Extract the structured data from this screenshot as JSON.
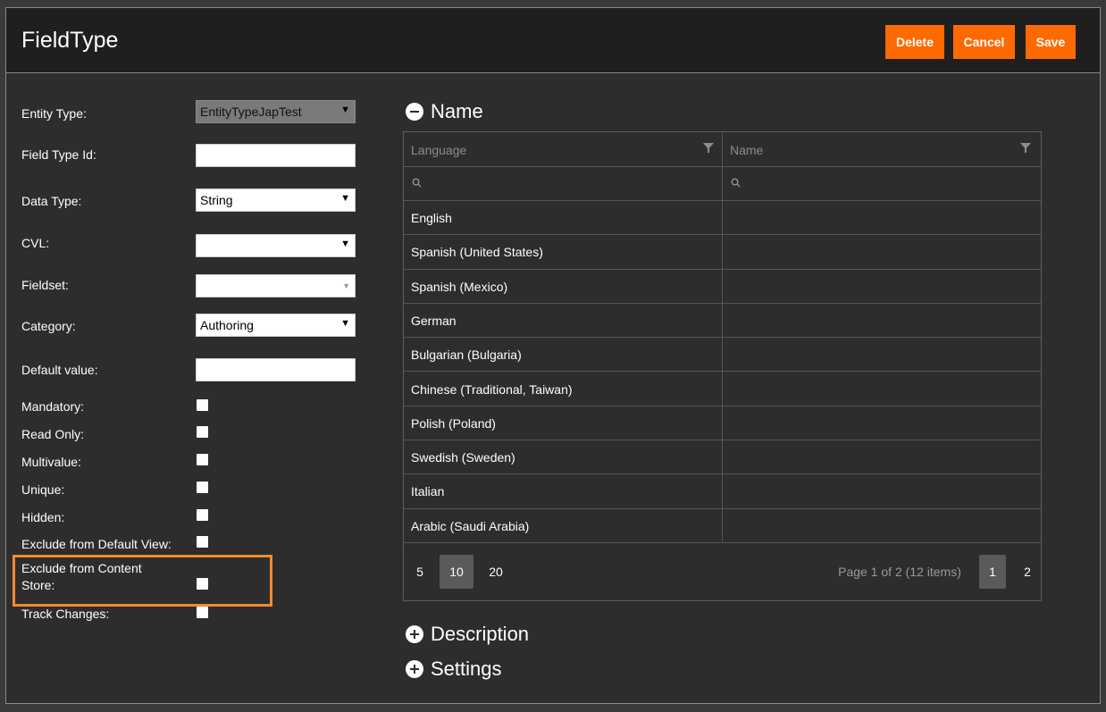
{
  "header": {
    "title": "FieldType",
    "delete_label": "Delete",
    "cancel_label": "Cancel",
    "save_label": "Save"
  },
  "form": {
    "entity_type": {
      "label": "Entity Type:",
      "value": "EntityTypeJapTest"
    },
    "field_type_id": {
      "label": "Field Type Id:",
      "value": ""
    },
    "data_type": {
      "label": "Data Type:",
      "value": "String"
    },
    "cvl": {
      "label": "CVL:",
      "value": ""
    },
    "fieldset": {
      "label": "Fieldset:",
      "value": ""
    },
    "category": {
      "label": "Category:",
      "value": "Authoring"
    },
    "default_value": {
      "label": "Default value:",
      "value": ""
    },
    "mandatory": {
      "label": "Mandatory:"
    },
    "read_only": {
      "label": "Read Only:"
    },
    "multivalue": {
      "label": "Multivalue:"
    },
    "unique": {
      "label": "Unique:"
    },
    "hidden": {
      "label": "Hidden:"
    },
    "exclude_default_view": {
      "label": "Exclude from Default View:"
    },
    "exclude_content_store": {
      "label_line1": "Exclude from Content",
      "label_line2": "Store:"
    },
    "track_changes": {
      "label": "Track Changes:"
    }
  },
  "name_section": {
    "title": "Name",
    "columns": [
      "Language",
      "Name"
    ],
    "rows": [
      {
        "language": "English",
        "name": ""
      },
      {
        "language": "Spanish (United States)",
        "name": ""
      },
      {
        "language": "Spanish (Mexico)",
        "name": ""
      },
      {
        "language": "German",
        "name": ""
      },
      {
        "language": "Bulgarian (Bulgaria)",
        "name": ""
      },
      {
        "language": "Chinese (Traditional, Taiwan)",
        "name": ""
      },
      {
        "language": "Polish (Poland)",
        "name": ""
      },
      {
        "language": "Swedish (Sweden)",
        "name": ""
      },
      {
        "language": "Italian",
        "name": ""
      },
      {
        "language": "Arabic (Saudi Arabia)",
        "name": ""
      }
    ],
    "page_sizes": [
      "5",
      "10",
      "20"
    ],
    "active_page_size": "10",
    "page_info": "Page 1 of 2 (12 items)",
    "pages": [
      "1",
      "2"
    ],
    "active_page": "1"
  },
  "description_section": {
    "title": "Description"
  },
  "settings_section": {
    "title": "Settings"
  },
  "colors": {
    "accent": "#ff6a00",
    "highlight": "#f28a2e",
    "background": "#2d2d2d"
  }
}
